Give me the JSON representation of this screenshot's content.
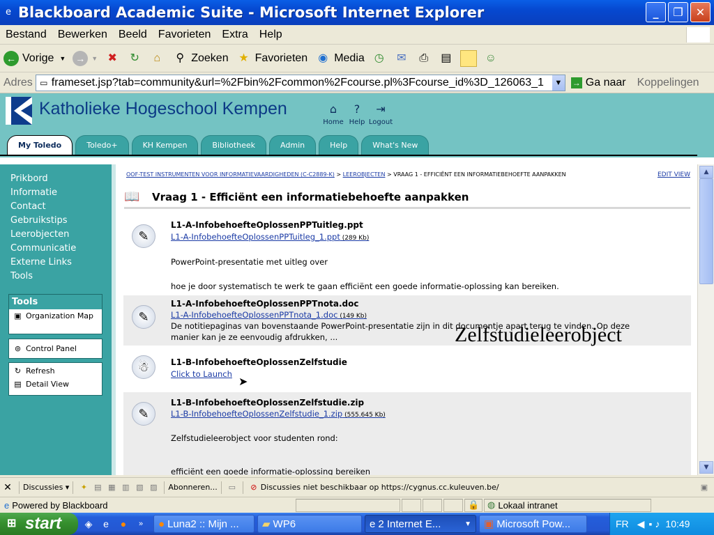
{
  "window": {
    "title": "Blackboard Academic Suite - Microsoft Internet Explorer",
    "min": "_",
    "max": "❐",
    "close": "✕"
  },
  "menu": [
    "Bestand",
    "Bewerken",
    "Beeld",
    "Favorieten",
    "Extra",
    "Help"
  ],
  "toolbar": {
    "back": "Vorige",
    "search": "Zoeken",
    "favorites": "Favorieten",
    "media": "Media"
  },
  "address": {
    "label": "Adres",
    "url": "frameset.jsp?tab=community&url=%2Fbin%2Fcommon%2Fcourse.pl%3Fcourse_id%3D_126063_1",
    "go": "Ga naar",
    "links": "Koppelingen"
  },
  "header": {
    "org": "Katholieke Hogeschool Kempen",
    "nav": [
      "Home",
      "Help",
      "Logout"
    ]
  },
  "tabs": [
    "My Toledo",
    "Toledo+",
    "KH Kempen",
    "Bibliotheek",
    "Admin",
    "Help",
    "What's New"
  ],
  "left_nav": [
    "Prikbord",
    "Informatie",
    "Contact",
    "Gebruikstips",
    "Leerobjecten",
    "Communicatie",
    "Externe Links",
    "Tools"
  ],
  "tools_box": {
    "heading": "Tools",
    "org_map": "Organization Map"
  },
  "control_panel": "Control Panel",
  "view_box": {
    "refresh": "Refresh",
    "detail": "Detail View"
  },
  "breadcrumb": {
    "course": "OOF-TEST INSTRUMENTEN VOOR INFORMATIEVAARDIGHEDEN (C-C2889-K)",
    "sep1": " > ",
    "section": "LEEROBJECTEN",
    "sep2": " > ",
    "current": "VRAAG 1 - EFFICIËNT EEN INFORMATIEBEHOEFTE AANPAKKEN",
    "edit": "EDIT VIEW"
  },
  "page_title": "Vraag 1 - Efficiënt een informatiebehoefte aanpakken",
  "items": [
    {
      "title": "L1-A-InfobehoefteOplossenPPTuitleg.ppt",
      "link": "L1-A-InfobehoefteOplossenPPTuitleg_1.ppt",
      "size": " (289 Kb)",
      "desc1": "PowerPoint-presentatie met uitleg over",
      "desc2": "hoe je door systematisch te werk te gaan efficiënt een goede informatie-oplossing kan bereiken."
    },
    {
      "title": "L1-A-InfobehoefteOplossenPPTnota.doc",
      "link": "L1-A-InfobehoefteOplossenPPTnota_1.doc",
      "size": " (149 Kb)",
      "desc1": "De notitiepaginas van bovenstaande PowerPoint-presentatie zijn in dit documentje apart terug te vinden. Op deze manier kan je ze eenvoudig afdrukken, ..."
    },
    {
      "title": "L1-B-InfobehoefteOplossenZelfstudie",
      "link": "Click to Launch"
    },
    {
      "title": "L1-B-InfobehoefteOplossenZelfstudie.zip",
      "link": "L1-B-InfobehoefteOplossenZelfstudie_1.zip",
      "size": " (555.645 Kb)",
      "desc1": "Zelfstudieleerobject voor studenten rond:",
      "desc2": "efficiënt een goede informatie-oplossing bereiken"
    }
  ],
  "overlay_text": "Zelfstudieleerobject",
  "discussion_bar": {
    "label": "Discussies",
    "subscribe": "Abonneren...",
    "message": "Discussies niet beschikbaar op https://cygnus.cc.kuleuven.be/"
  },
  "status": {
    "left": "Powered by Blackboard",
    "zone": "Lokaal intranet"
  },
  "taskbar": {
    "start": "start",
    "tasks": [
      "Luna2 :: Mijn ...",
      "WP6",
      "2 Internet E...",
      "Microsoft Pow..."
    ],
    "lang": "FR",
    "time": "10:49"
  },
  "colors": {
    "teal": "#74c3c3",
    "teal_dark": "#3aa3a3",
    "navy": "#0c3a86",
    "link": "#1a3aa5"
  }
}
